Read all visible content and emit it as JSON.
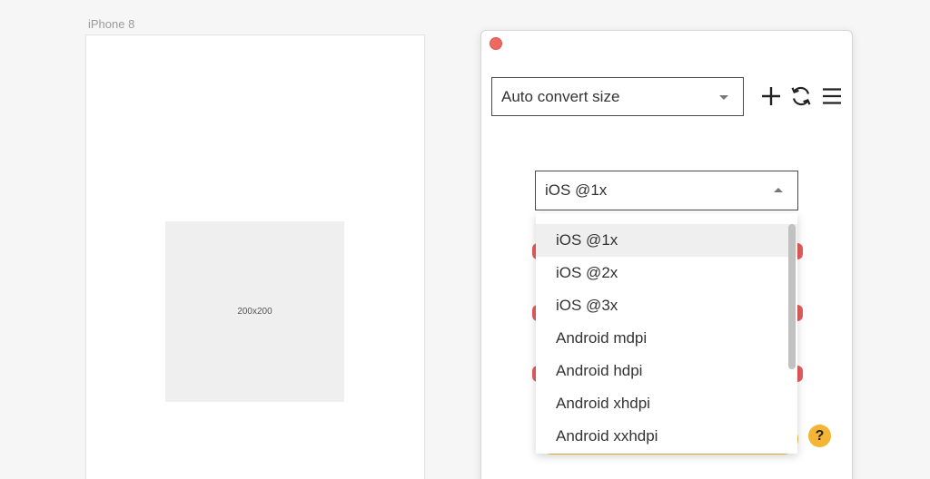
{
  "artboard": {
    "label": "iPhone 8",
    "placeholder_text": "200x200"
  },
  "panel": {
    "mode_select": {
      "value": "Auto convert size"
    },
    "toolbar": {
      "add_icon": "plus-icon",
      "refresh_icon": "refresh-icon",
      "menu_icon": "hamburger-menu-icon"
    },
    "size_select": {
      "value": "iOS @1x",
      "options": [
        "iOS @1x",
        "iOS @2x",
        "iOS @3x",
        "Android mdpi",
        "Android hdpi",
        "Android xhdpi",
        "Android xxhdpi"
      ]
    },
    "help_label": "?",
    "colors": {
      "close": "#ee6a5f",
      "accent": "#f5b534",
      "row_dot": "#e55d5d"
    }
  }
}
